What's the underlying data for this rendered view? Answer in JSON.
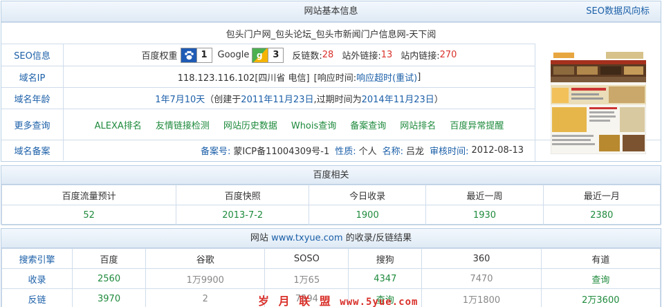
{
  "basic": {
    "title": "网站基本信息",
    "seo_link": "SEO数据风向标",
    "site_title": "包头门户网_包头论坛_包头市新闻门户信息网-天下阅",
    "seo_label": "SEO信息",
    "baidu_weight_label": "百度权重",
    "baidu_weight_value": "1",
    "google_label": "Google",
    "google_value": "3",
    "backlinks_label": "反链数:",
    "backlinks_value": "28",
    "external_label": "站外链接:",
    "external_value": "13",
    "internal_label": "站内链接:",
    "internal_value": "270",
    "ip_label": "域名IP",
    "ip_value": "118.123.116.102[四川省 电信]",
    "response_prefix": "[响应时间:",
    "response_value": "响应超时(重试)",
    "response_suffix": "]",
    "age_label": "域名年龄",
    "age_value": "1年7月10天",
    "age_created_prefix": "（创建于",
    "age_created": "2011年11月23日",
    "age_expire_prefix": ",过期时间为",
    "age_expire": "2014年11月23日",
    "age_suffix": "）",
    "more_label": "更多查询",
    "more_links": [
      "ALEXA排名",
      "友情链接检测",
      "网站历史数据",
      "Whois查询",
      "备案查询",
      "网站排名",
      "百度异常提醒"
    ],
    "record_label": "域名备案",
    "record_no_label": "备案号:",
    "record_no": "蒙ICP备11004309号-1",
    "nature_label": "性质:",
    "nature": "个人",
    "name_label": "名称:",
    "name": "吕龙",
    "audit_label": "审核时间:",
    "audit": "2012-08-13"
  },
  "baidu": {
    "title": "百度相关",
    "headers": [
      "百度流量预计",
      "百度快照",
      "今日收录",
      "最近一周",
      "最近一月"
    ],
    "values": [
      "52",
      "2013-7-2",
      "1900",
      "1930",
      "2380"
    ]
  },
  "engines": {
    "title_prefix": "网站",
    "domain": "www.txyue.com",
    "title_suffix": "的收录/反链结果",
    "headers": [
      "搜索引擎",
      "百度",
      "谷歌",
      "SOSO",
      "搜狗",
      "360",
      "有道"
    ],
    "rows": [
      [
        "收录",
        "2560",
        "1万9900",
        "1万65",
        "4347",
        "7470",
        "查询"
      ],
      [
        "反链",
        "3970",
        "2",
        "7594",
        "查询",
        "1万1800",
        "2万3600"
      ]
    ]
  },
  "watermark": {
    "text": "岁 月 联 盟",
    "url": "www.5yue.com"
  },
  "colors": {
    "link_blue": "#1b5fa8",
    "green": "#1e8a3c",
    "red": "#d9302a",
    "border": "#b9cfe4"
  }
}
